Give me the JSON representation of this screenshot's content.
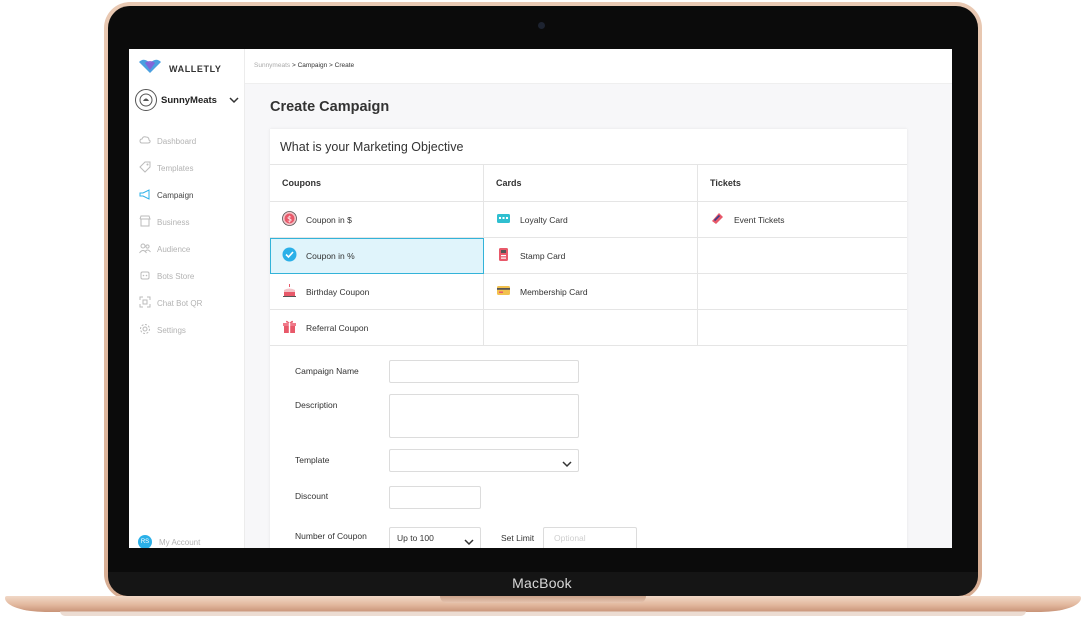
{
  "device": {
    "brand_label": "MacBook"
  },
  "sidebar": {
    "logo_text": "WALLETLY",
    "org_name": "SunnyMeats",
    "items": [
      {
        "label": "Dashboard",
        "icon": "cloud-icon"
      },
      {
        "label": "Templates",
        "icon": "tag-icon"
      },
      {
        "label": "Campaign",
        "icon": "megaphone-icon"
      },
      {
        "label": "Business",
        "icon": "storefront-icon"
      },
      {
        "label": "Audience",
        "icon": "people-icon"
      },
      {
        "label": "Bots Store",
        "icon": "bot-icon"
      },
      {
        "label": "Chat Bot QR",
        "icon": "qr-icon"
      },
      {
        "label": "Settings",
        "icon": "gear-icon"
      }
    ],
    "account": {
      "initials": "RS",
      "label": "My Account"
    }
  },
  "breadcrumb": {
    "root": "Sunnymeats",
    "sep1": ">",
    "section": "Campaign",
    "sep2": ">",
    "current": "Create"
  },
  "page_title": "Create Campaign",
  "objective": {
    "title": "What is your Marketing Objective",
    "columns": [
      "Coupons",
      "Cards",
      "Tickets"
    ],
    "rows": [
      {
        "coupons": "Coupon in $",
        "cards": "Loyalty Card",
        "tickets": "Event Tickets"
      },
      {
        "coupons": "Coupon in %",
        "cards": "Stamp Card",
        "tickets": ""
      },
      {
        "coupons": "Birthday Coupon",
        "cards": "Membership Card",
        "tickets": ""
      },
      {
        "coupons": "Referral Coupon",
        "cards": "",
        "tickets": ""
      }
    ],
    "selected": "Coupon in %"
  },
  "form": {
    "campaign_name_label": "Campaign Name",
    "campaign_name_value": "",
    "description_label": "Description",
    "description_value": "",
    "template_label": "Template",
    "template_value": "",
    "discount_label": "Discount",
    "discount_value": "",
    "coupon_count_label": "Number of Coupon",
    "coupon_count_value": "Up to 100",
    "set_limit_label": "Set Limit",
    "set_limit_placeholder": "Optional"
  },
  "colors": {
    "accent": "#2bb0e8",
    "selected_bg": "#e0f4fb",
    "logo_blue": "#4a9fe0",
    "logo_purple": "#8a5cd6"
  }
}
